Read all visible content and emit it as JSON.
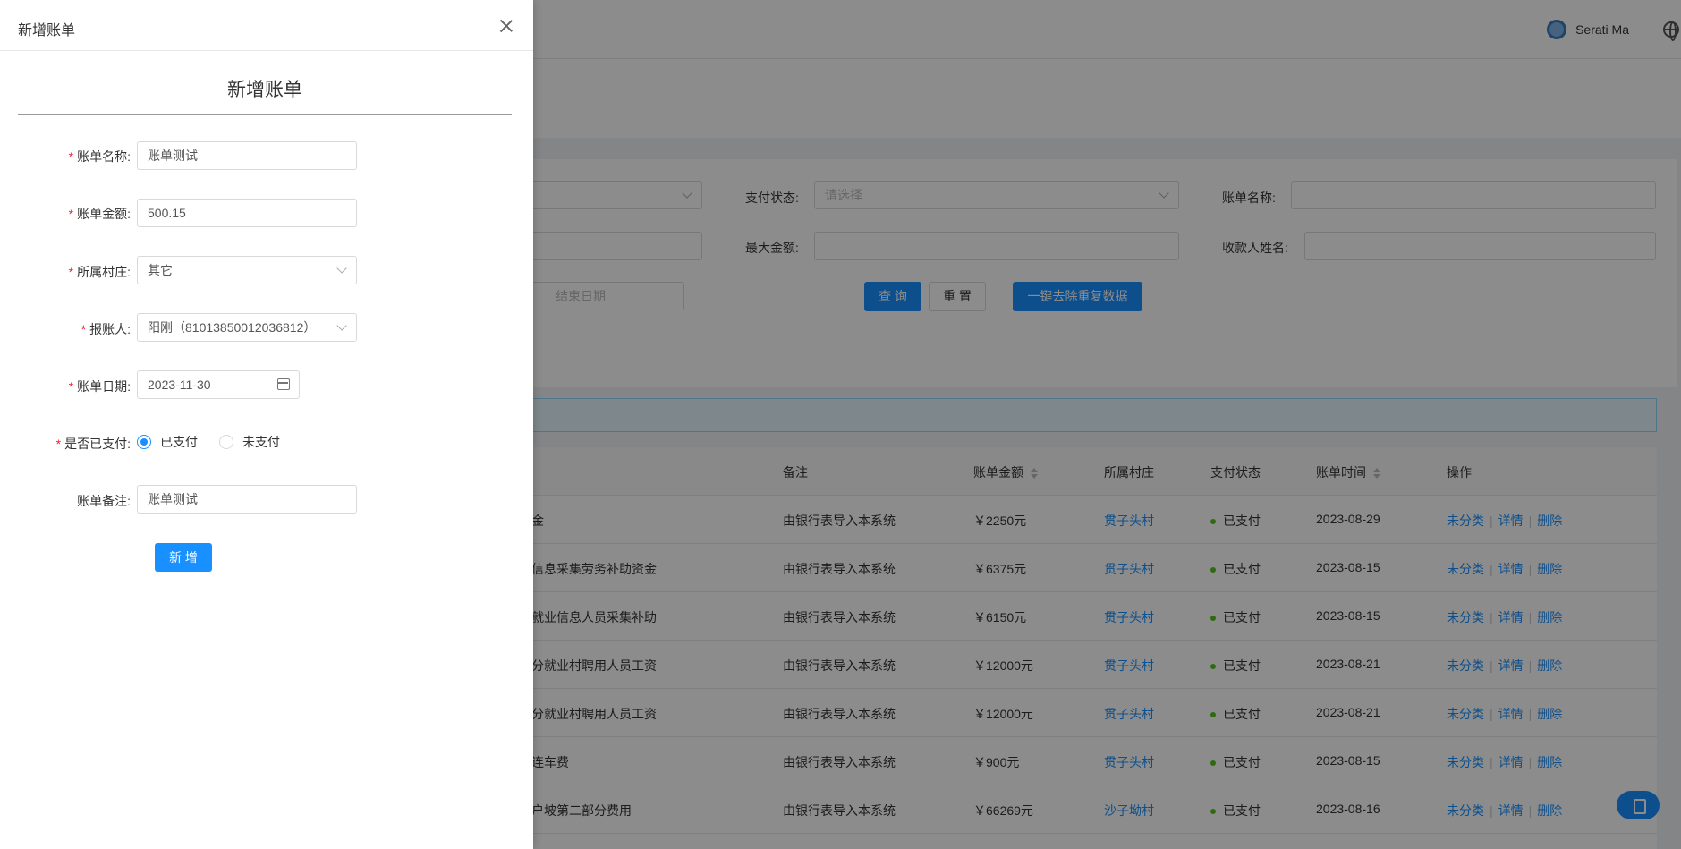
{
  "header": {
    "user_name": "Serati Ma"
  },
  "filters": {
    "pay_status_label": "支付状态:",
    "pay_status_placeholder": "请选择",
    "bill_name_label": "账单名称:",
    "max_amount_label": "最大金额:",
    "payee_name_label": "收款人姓名:",
    "end_date_placeholder": "结束日期",
    "query_button": "查 询",
    "reset_button": "重 置",
    "dedupe_button": "一键去除重复数据"
  },
  "table": {
    "columns": {
      "remark": "备注",
      "amount": "账单金额",
      "village": "所属村庄",
      "pay_status": "支付状态",
      "bill_time": "账单时间",
      "actions": "操作"
    },
    "action_labels": {
      "categorize": "未分类",
      "detail": "详情",
      "delete": "删除"
    },
    "rows": [
      {
        "name": "金",
        "remark": "由银行表导入本系统",
        "amount": "￥2250元",
        "village": "贯子头村",
        "status": "已支付",
        "date": "2023-08-29"
      },
      {
        "name": "信息采集劳务补助资金",
        "remark": "由银行表导入本系统",
        "amount": "￥6375元",
        "village": "贯子头村",
        "status": "已支付",
        "date": "2023-08-15"
      },
      {
        "name": "就业信息人员采集补助",
        "remark": "由银行表导入本系统",
        "amount": "￥6150元",
        "village": "贯子头村",
        "status": "已支付",
        "date": "2023-08-15"
      },
      {
        "name": "分就业村聘用人员工资",
        "remark": "由银行表导入本系统",
        "amount": "￥12000元",
        "village": "贯子头村",
        "status": "已支付",
        "date": "2023-08-21"
      },
      {
        "name": "分就业村聘用人员工资",
        "remark": "由银行表导入本系统",
        "amount": "￥12000元",
        "village": "贯子头村",
        "status": "已支付",
        "date": "2023-08-21"
      },
      {
        "name": "连车费",
        "remark": "由银行表导入本系统",
        "amount": "￥900元",
        "village": "贯子头村",
        "status": "已支付",
        "date": "2023-08-15"
      },
      {
        "name": "户坡第二部分费用",
        "remark": "由银行表导入本系统",
        "amount": "￥66269元",
        "village": "沙子坳村",
        "status": "已支付",
        "date": "2023-08-16"
      }
    ]
  },
  "drawer": {
    "header_title": "新增账单",
    "form_title": "新增账单",
    "required_mark": "*",
    "fields": {
      "bill_name": {
        "label": "账单名称:",
        "value": "账单测试"
      },
      "bill_amount": {
        "label": "账单金额:",
        "value": "500.15"
      },
      "village": {
        "label": "所属村庄:",
        "value": "其它"
      },
      "reporter": {
        "label": "报账人:",
        "value": "阳刚（81013850012036812）"
      },
      "bill_date": {
        "label": "账单日期:",
        "value": "2023-11-30"
      },
      "paid": {
        "label": "是否已支付:",
        "option_paid": "已支付",
        "option_unpaid": "未支付",
        "selected": "已支付"
      },
      "remark": {
        "label": "账单备注:",
        "value": "账单测试"
      }
    },
    "submit_label": "新 增"
  },
  "colors": {
    "primary": "#1890ff",
    "success": "#52c41a",
    "required": "#f5222d"
  }
}
